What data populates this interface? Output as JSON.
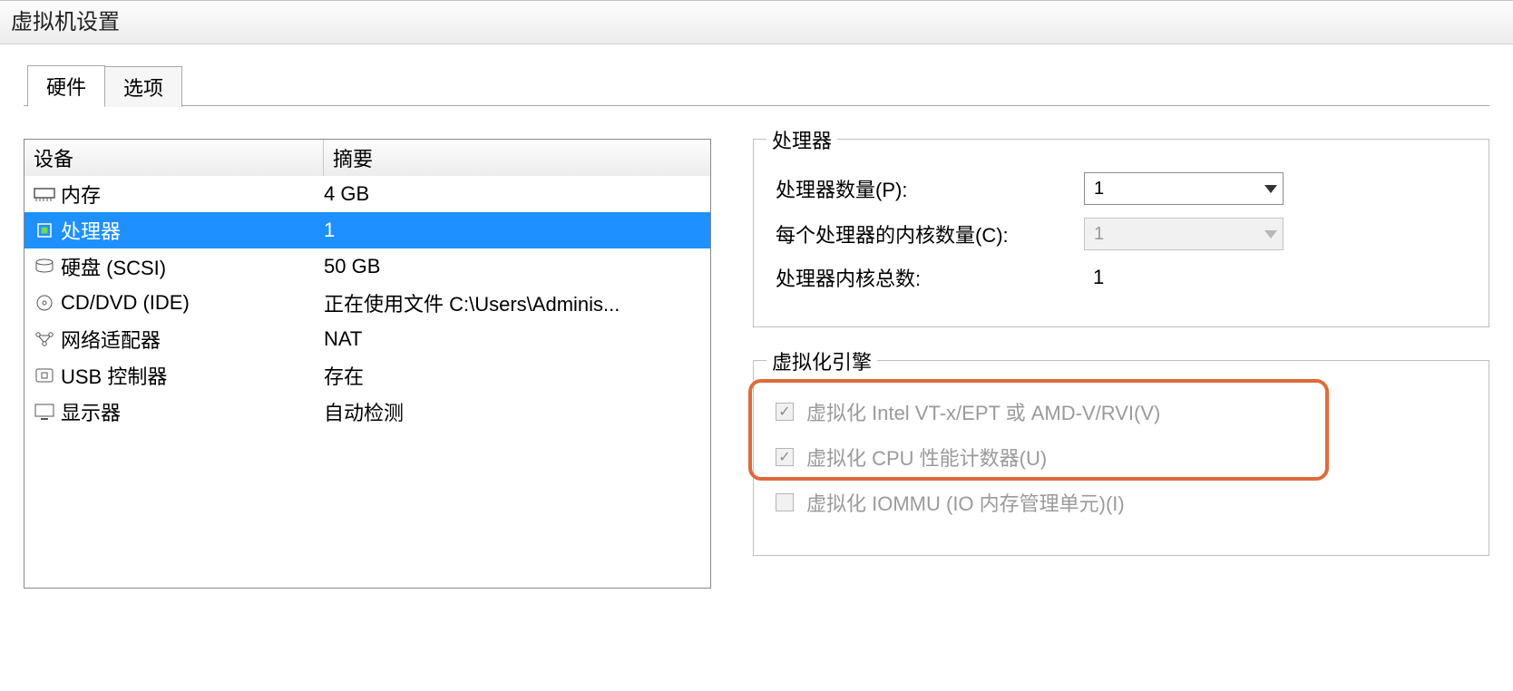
{
  "window": {
    "title": "虚拟机设置"
  },
  "tabs": {
    "hardware": "硬件",
    "options": "选项"
  },
  "headers": {
    "device": "设备",
    "summary": "摘要"
  },
  "devices": {
    "memory": {
      "label": "内存",
      "summary": "4 GB"
    },
    "cpu": {
      "label": "处理器",
      "summary": "1"
    },
    "disk": {
      "label": "硬盘 (SCSI)",
      "summary": "50 GB"
    },
    "cd": {
      "label": "CD/DVD (IDE)",
      "summary": "正在使用文件 C:\\Users\\Adminis..."
    },
    "net": {
      "label": "网络适配器",
      "summary": "NAT"
    },
    "usb": {
      "label": "USB 控制器",
      "summary": "存在"
    },
    "display": {
      "label": "显示器",
      "summary": "自动检测"
    }
  },
  "cpu_group": {
    "legend": "处理器",
    "num_label": "处理器数量(P):",
    "num_value": "1",
    "cores_label": "每个处理器的内核数量(C):",
    "cores_value": "1",
    "total_label": "处理器内核总数:",
    "total_value": "1"
  },
  "virt_group": {
    "legend": "虚拟化引擎",
    "vt": "虚拟化 Intel VT-x/EPT 或 AMD-V/RVI(V)",
    "perf": "虚拟化 CPU 性能计数器(U)",
    "iommu": "虚拟化 IOMMU (IO 内存管理单元)(I)"
  }
}
